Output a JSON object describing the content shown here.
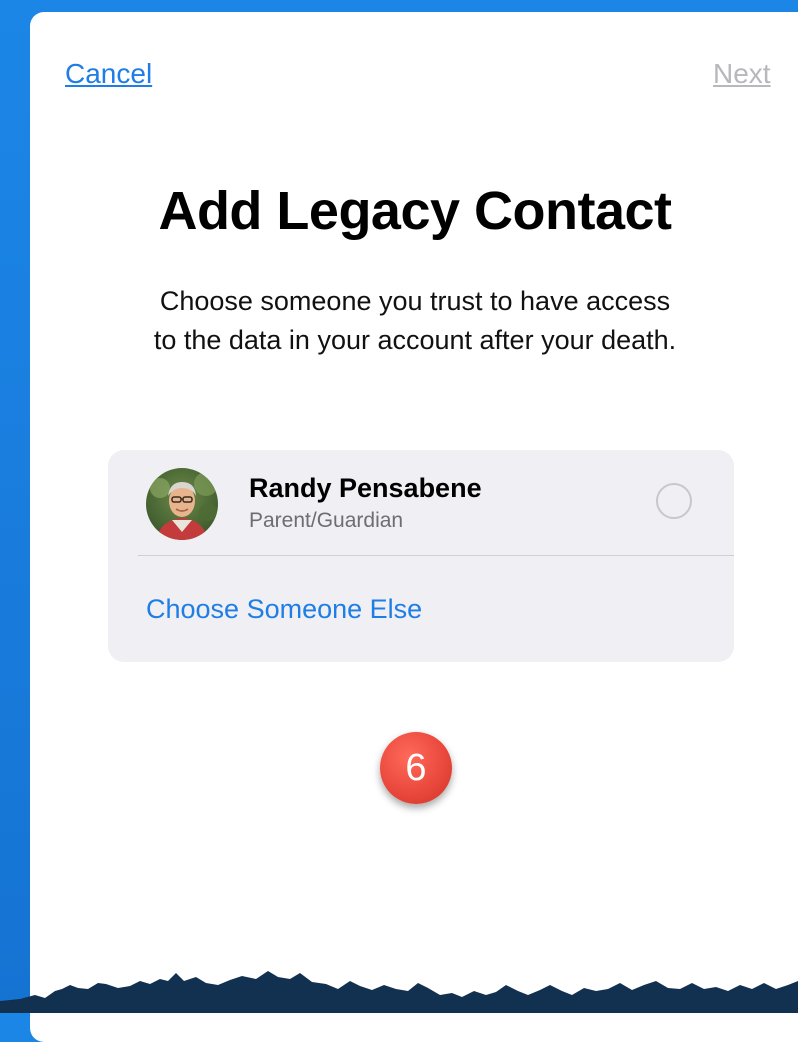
{
  "nav": {
    "cancel_label": "Cancel",
    "next_label": "Next"
  },
  "header": {
    "title": "Add Legacy Contact",
    "subtitle_line1": "Choose someone you trust to have access",
    "subtitle_line2": "to the data in your account after your death."
  },
  "contacts": [
    {
      "name": "Randy Pensabene",
      "relation": "Parent/Guardian",
      "selected": false
    }
  ],
  "choose_else_label": "Choose Someone Else",
  "step_badge": "6",
  "colors": {
    "accent": "#1f7de6",
    "disabled": "#b7b7bc",
    "card_bg": "#efeff4",
    "badge": "#e8463a",
    "frame": "#1a7fe0"
  }
}
